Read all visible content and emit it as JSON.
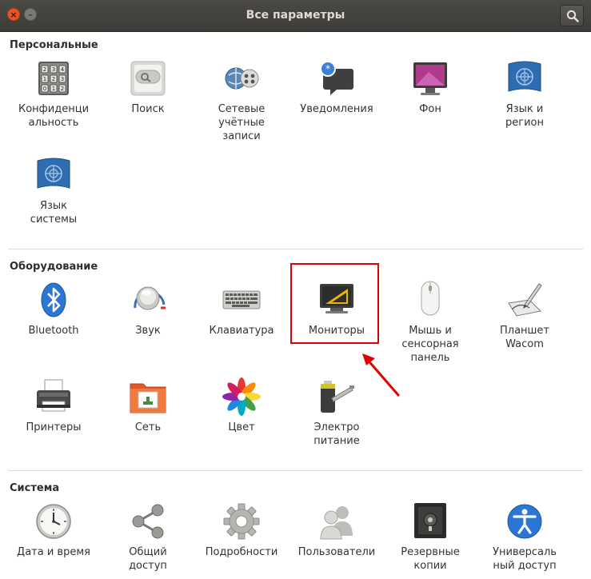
{
  "window": {
    "title": "Все параметры",
    "close_glyph": "×",
    "minimize_glyph": "–"
  },
  "sections": {
    "personal": {
      "title": "Персональные",
      "items": [
        {
          "label": "Конфиденци\nальность",
          "icon": "privacy-lock-icon"
        },
        {
          "label": "Поиск",
          "icon": "search-icon"
        },
        {
          "label": "Сетевые\nучётные\nзаписи",
          "icon": "online-accounts-icon"
        },
        {
          "label": "Уведомления",
          "icon": "notifications-icon"
        },
        {
          "label": "Фон",
          "icon": "background-icon"
        },
        {
          "label": "Язык и\nрегион",
          "icon": "language-region-icon"
        },
        {
          "label": "Язык\nсистемы",
          "icon": "system-language-icon"
        }
      ]
    },
    "hardware": {
      "title": "Оборудование",
      "items": [
        {
          "label": "Bluetooth",
          "icon": "bluetooth-icon"
        },
        {
          "label": "Звук",
          "icon": "sound-icon"
        },
        {
          "label": "Клавиатура",
          "icon": "keyboard-icon"
        },
        {
          "label": "Мониторы",
          "icon": "displays-icon"
        },
        {
          "label": "Мышь и\nсенсорная\nпанель",
          "icon": "mouse-icon"
        },
        {
          "label": "Планшет\nWacom",
          "icon": "wacom-tablet-icon"
        },
        {
          "label": "Принтеры",
          "icon": "printer-icon"
        },
        {
          "label": "Сеть",
          "icon": "network-icon"
        },
        {
          "label": "Цвет",
          "icon": "color-icon"
        },
        {
          "label": "Электро\nпитание",
          "icon": "power-icon"
        }
      ]
    },
    "system": {
      "title": "Система",
      "items": [
        {
          "label": "Дата и время",
          "icon": "clock-icon"
        },
        {
          "label": "Общий\nдоступ",
          "icon": "sharing-icon"
        },
        {
          "label": "Подробности",
          "icon": "details-gear-icon"
        },
        {
          "label": "Пользователи",
          "icon": "users-icon"
        },
        {
          "label": "Резервные\nкопии",
          "icon": "backup-safe-icon"
        },
        {
          "label": "Универсаль\nный доступ",
          "icon": "accessibility-icon"
        }
      ]
    }
  },
  "colors": {
    "titlebar": "#3d3c38",
    "close_button": "#e95420",
    "highlight": "#e00000"
  }
}
